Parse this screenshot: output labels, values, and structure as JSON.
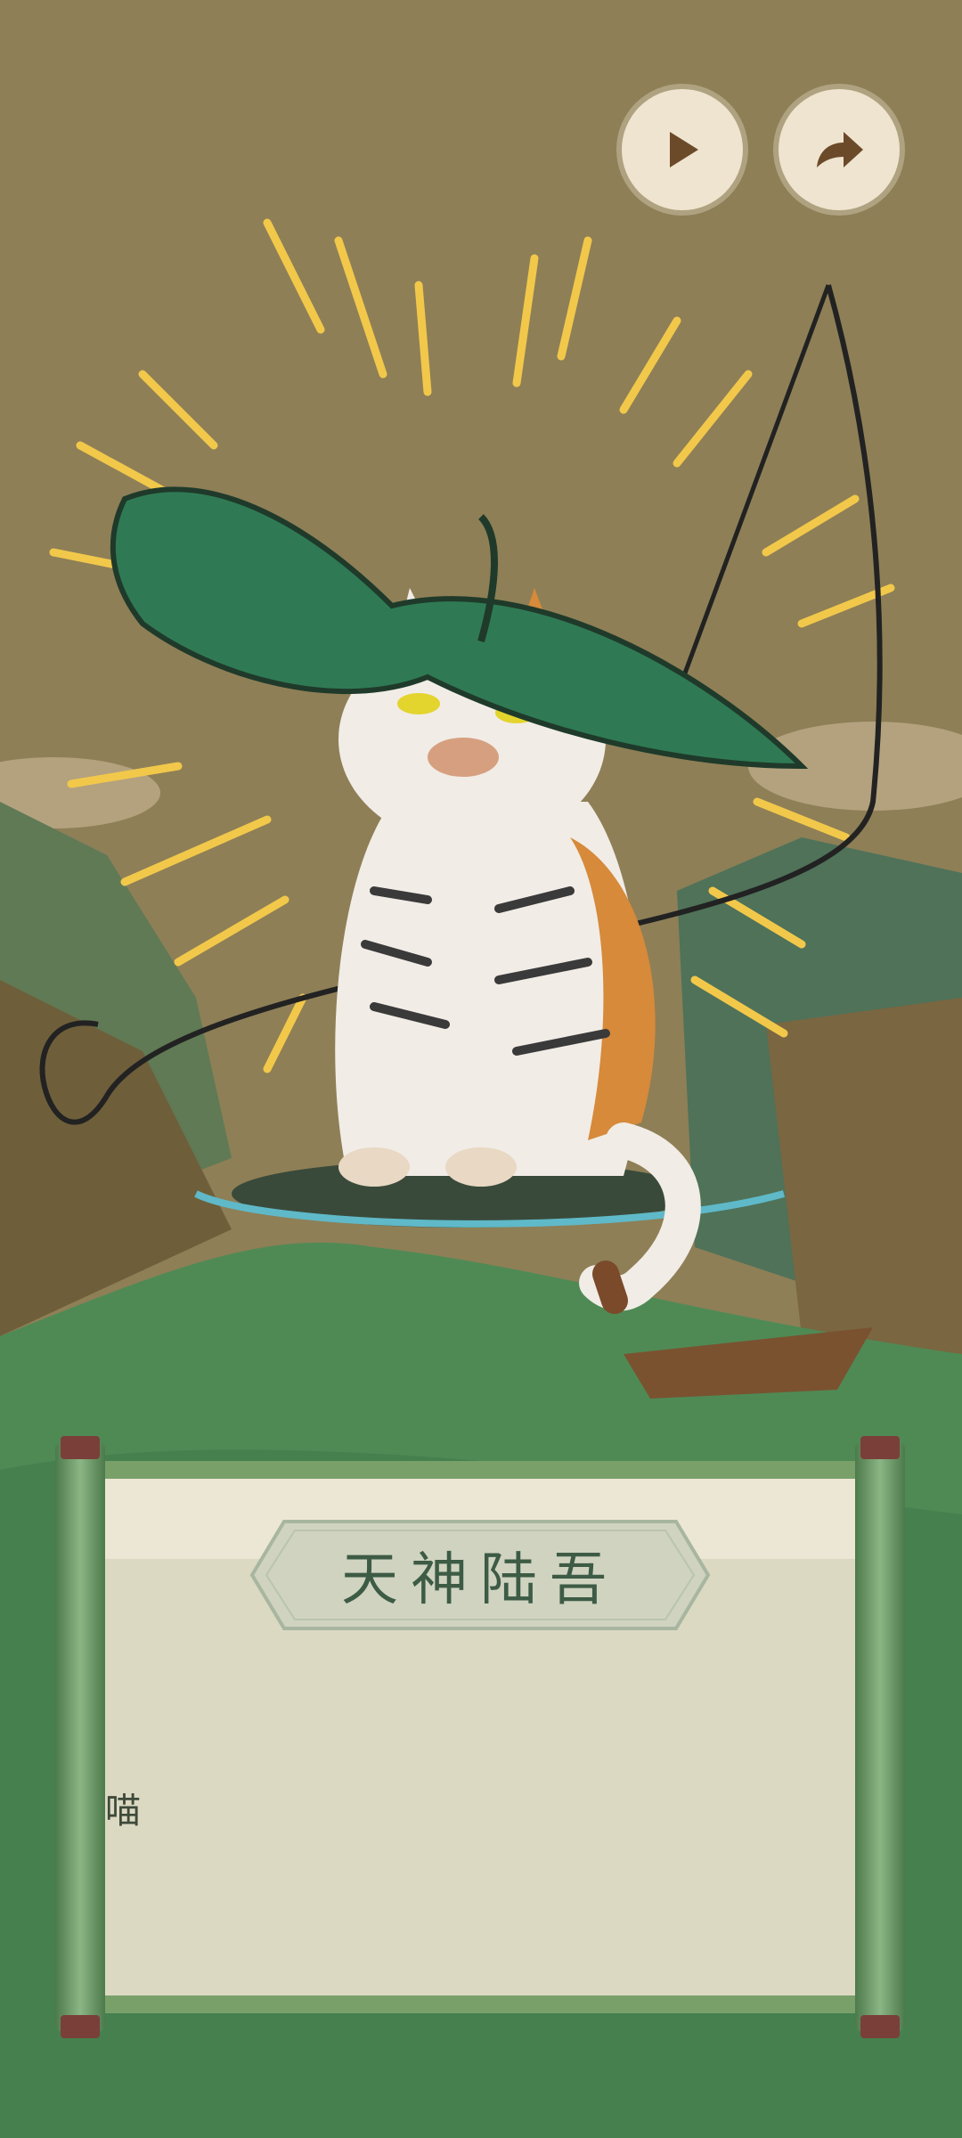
{
  "controls": {
    "play_icon": "play-icon",
    "share_icon": "share-arrow-icon"
  },
  "character": {
    "name": "天神陆吾"
  },
  "dialog": {
    "text": "喵"
  },
  "colors": {
    "sky": "#8e7f56",
    "water": "#4f8a55",
    "leaf": "#2f7a54",
    "rays": "#f2c84b",
    "scroll_frame": "#7aa06a",
    "title_text": "#3d5b45"
  }
}
